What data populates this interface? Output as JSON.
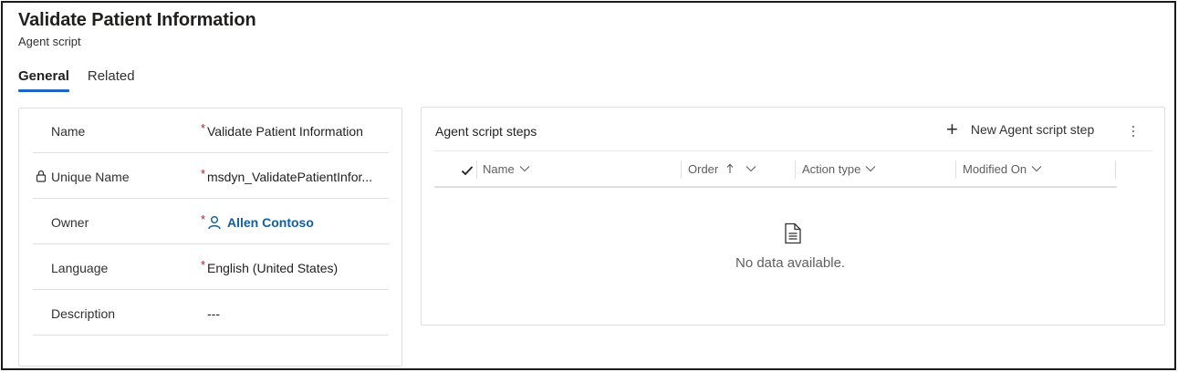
{
  "header": {
    "title": "Validate Patient Information",
    "subtitle": "Agent script"
  },
  "tabs": [
    {
      "label": "General",
      "active": true
    },
    {
      "label": "Related",
      "active": false
    }
  ],
  "form": {
    "fields": [
      {
        "label": "Name",
        "required": "*",
        "value": "Validate Patient Information",
        "locked": false
      },
      {
        "label": "Unique Name",
        "required": "*",
        "value": "msdyn_ValidatePatientInfor...",
        "locked": true
      },
      {
        "label": "Owner",
        "required": "*",
        "value": "Allen Contoso",
        "locked": false
      },
      {
        "label": "Language",
        "required": "*",
        "value": "English (United States)",
        "locked": false
      },
      {
        "label": "Description",
        "required": "",
        "value": "---",
        "locked": false
      }
    ]
  },
  "grid": {
    "title": "Agent script steps",
    "new_button_label": "New Agent script step",
    "columns": [
      {
        "label": "Name"
      },
      {
        "label": "Order"
      },
      {
        "label": "Action type"
      },
      {
        "label": "Modified On"
      }
    ],
    "empty_message": "No data available."
  },
  "colors": {
    "accent": "#2266c4",
    "link": "#115ea3",
    "required": "#a4262c",
    "border": "#e1dfdd"
  },
  "icons": [
    "lock-icon",
    "person-icon",
    "plus-icon",
    "more-vertical-icon",
    "checkmark-icon",
    "chevron-down-icon",
    "sort-ascending-icon",
    "document-icon"
  ]
}
